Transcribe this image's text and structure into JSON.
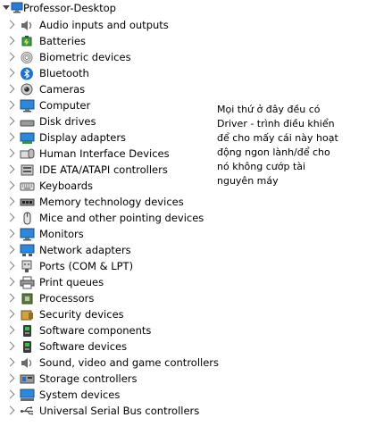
{
  "tree": {
    "root": {
      "label": "Professor-Desktop",
      "icon": "computer-icon"
    },
    "items": [
      {
        "label": "Audio inputs and outputs",
        "icon": "speaker-icon"
      },
      {
        "label": "Batteries",
        "icon": "battery-icon"
      },
      {
        "label": "Biometric devices",
        "icon": "fingerprint-icon"
      },
      {
        "label": "Bluetooth",
        "icon": "bluetooth-icon"
      },
      {
        "label": "Cameras",
        "icon": "camera-icon"
      },
      {
        "label": "Computer",
        "icon": "monitor-icon"
      },
      {
        "label": "Disk drives",
        "icon": "disk-drive-icon"
      },
      {
        "label": "Display adapters",
        "icon": "display-adapter-icon"
      },
      {
        "label": "Human Interface Devices",
        "icon": "hid-icon"
      },
      {
        "label": "IDE ATA/ATAPI controllers",
        "icon": "ide-controller-icon"
      },
      {
        "label": "Keyboards",
        "icon": "keyboard-icon"
      },
      {
        "label": "Memory technology devices",
        "icon": "memory-icon"
      },
      {
        "label": "Mice and other pointing devices",
        "icon": "mouse-icon"
      },
      {
        "label": "Monitors",
        "icon": "monitor-icon"
      },
      {
        "label": "Network adapters",
        "icon": "network-adapter-icon"
      },
      {
        "label": "Ports (COM & LPT)",
        "icon": "port-icon"
      },
      {
        "label": "Print queues",
        "icon": "printer-icon"
      },
      {
        "label": "Processors",
        "icon": "processor-icon"
      },
      {
        "label": "Security devices",
        "icon": "security-icon"
      },
      {
        "label": "Software components",
        "icon": "software-component-icon"
      },
      {
        "label": "Software devices",
        "icon": "software-device-icon"
      },
      {
        "label": "Sound, video and game controllers",
        "icon": "speaker-icon"
      },
      {
        "label": "Storage controllers",
        "icon": "storage-controller-icon"
      },
      {
        "label": "System devices",
        "icon": "system-device-icon"
      },
      {
        "label": "Universal Serial Bus controllers",
        "icon": "usb-icon"
      }
    ]
  },
  "annotation": {
    "text": "Mọi thứ ở đây đều có\nDriver - trình điều khiển\nđể cho mấy cái này hoạt\nđộng ngon lành/để cho\nnó không cướp tài\nnguyên máy"
  }
}
